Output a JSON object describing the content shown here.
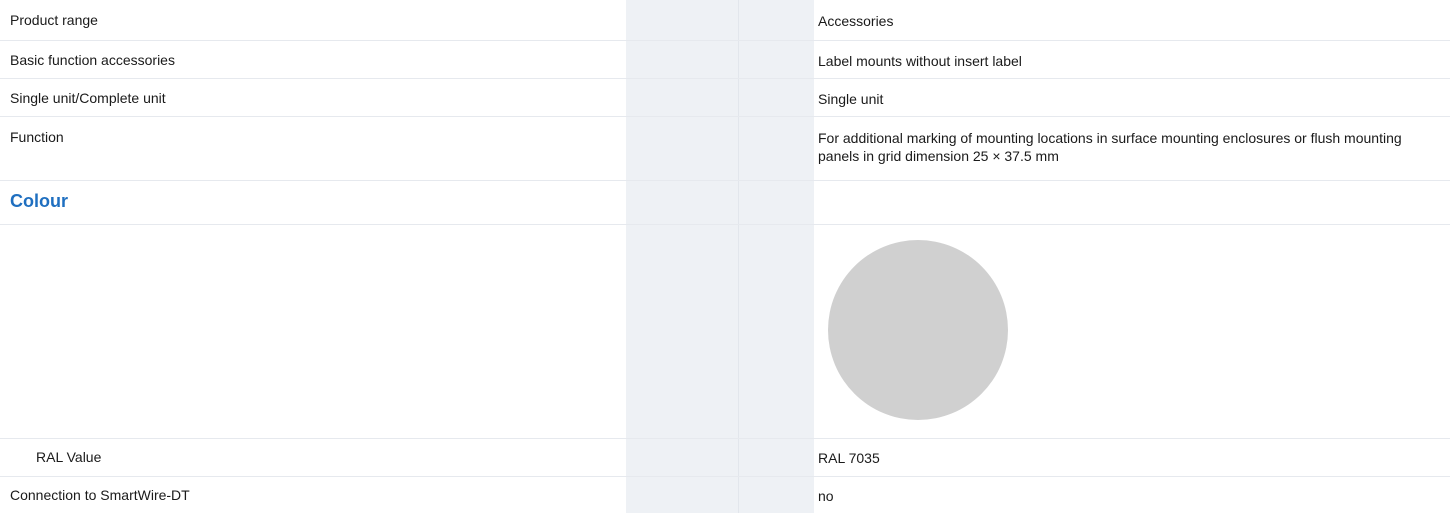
{
  "rows": [
    {
      "label": "Product range",
      "value": "Accessories"
    },
    {
      "label": "Basic function accessories",
      "value": "Label mounts without insert label"
    },
    {
      "label": "Single unit/Complete unit",
      "value": "Single unit"
    },
    {
      "label": "Function",
      "value": "For additional marking of mounting locations in surface mounting enclosures or flush mounting panels in grid dimension 25 × 37.5 mm"
    }
  ],
  "colour_section": {
    "heading": "Colour",
    "swatch_color": "#d0d0d0",
    "ral_label": "RAL Value",
    "ral_value": "RAL 7035"
  },
  "connection": {
    "label": "Connection to SmartWire-DT",
    "value": "no"
  }
}
